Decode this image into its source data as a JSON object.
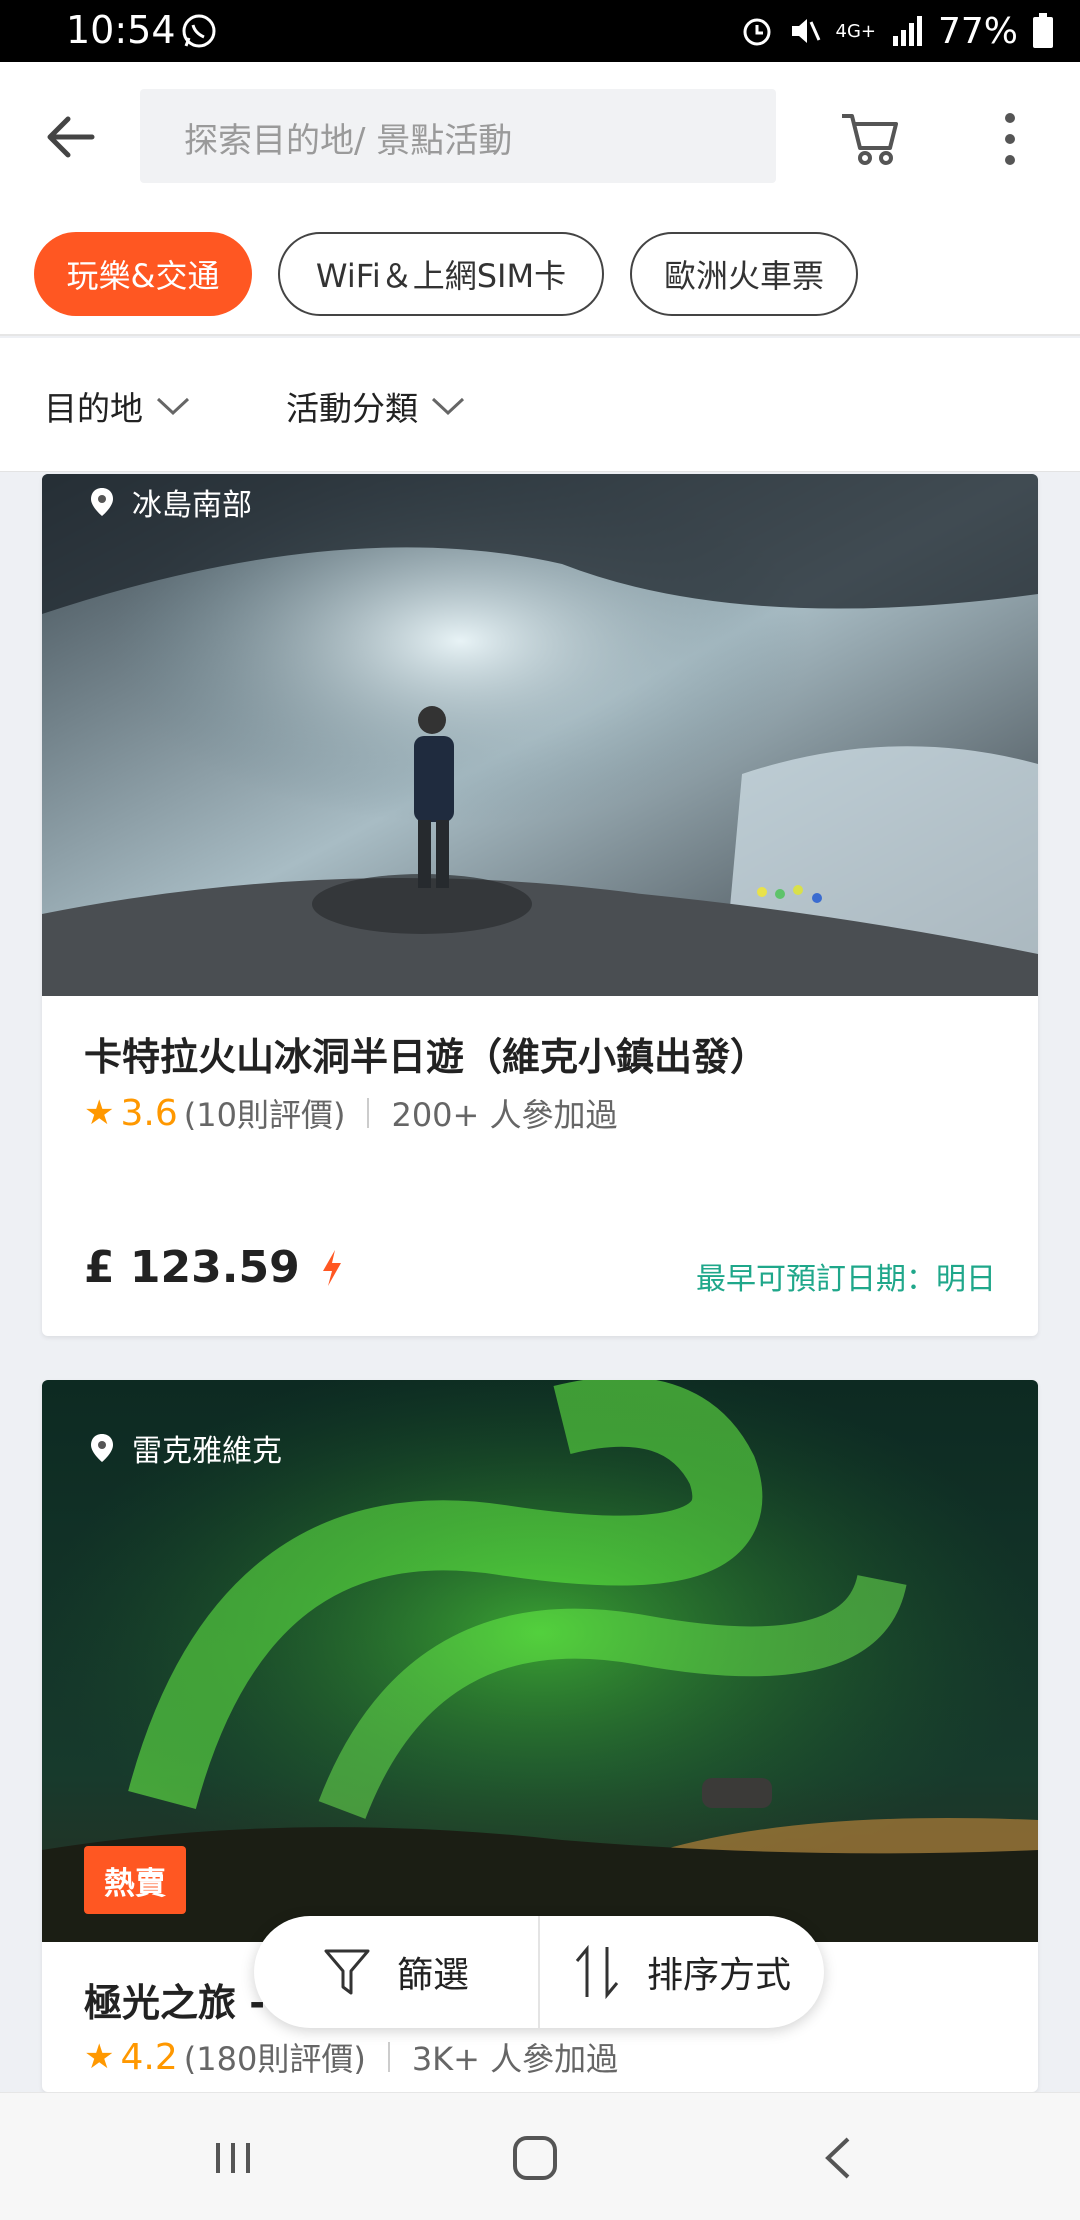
{
  "status": {
    "time": "10:54",
    "network": "4G+",
    "battery": "77%"
  },
  "search": {
    "placeholder": "探索目的地/ 景點活動"
  },
  "chips": [
    {
      "label": "玩樂&交通",
      "active": true
    },
    {
      "label": "WiFi＆上網SIM卡",
      "active": false
    },
    {
      "label": "歐洲火車票",
      "active": false
    }
  ],
  "filters": {
    "destination": "目的地",
    "category": "活動分類"
  },
  "cards": [
    {
      "location": "冰島南部",
      "title": "卡特拉火山冰洞半日遊（維克小鎮出發）",
      "rating": "3.6",
      "reviews": "(10則評價)",
      "participants": "200+ 人參加過",
      "price": "£ 123.59",
      "earliest": "最早可預訂日期：明日"
    },
    {
      "location": "雷克雅維克",
      "badge": "熱賣",
      "title": "極光之旅 -",
      "rating": "4.2",
      "reviews": "(180則評價)",
      "participants": "3K+ 人參加過"
    }
  ],
  "floating": {
    "filter_label": "篩選",
    "sort_label": "排序方式"
  },
  "colors": {
    "accent": "#ff5722",
    "rating": "#ff9800",
    "date": "#1fa78a"
  }
}
